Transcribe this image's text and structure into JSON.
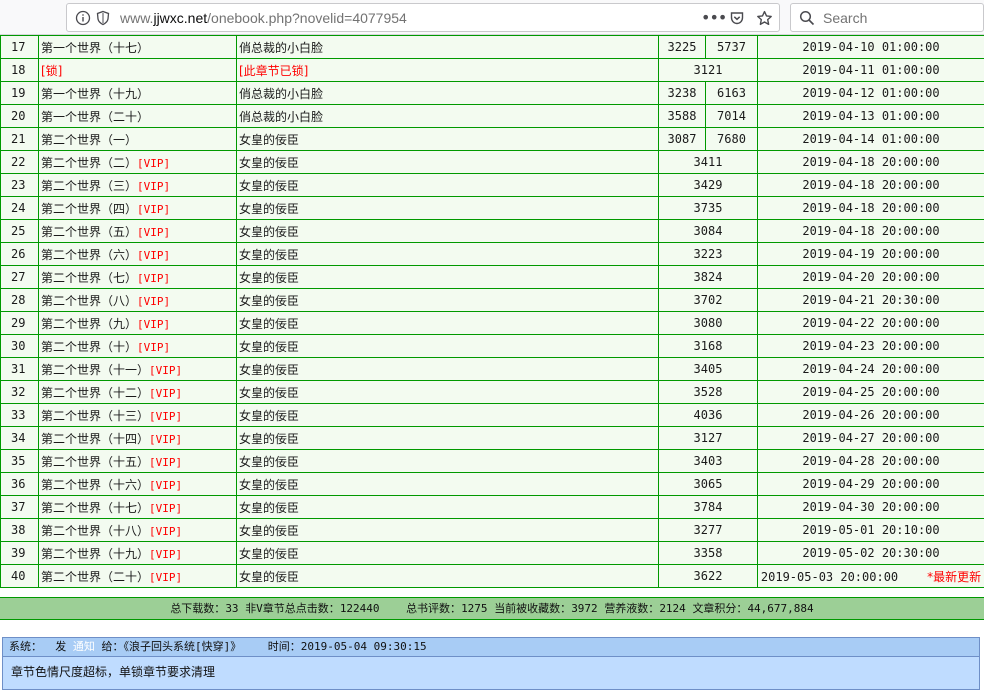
{
  "browser": {
    "url_prefix": "www.",
    "url_domain": "jjwxc.net",
    "url_path": "/onebook.php?novelid=4077954",
    "search_placeholder": "Search"
  },
  "chapters": [
    {
      "no": "17",
      "title": "第一个世界（十七）",
      "vip": "",
      "summary": "俏总裁的小白脸",
      "count": "3225",
      "extra": "5737",
      "date": "2019-04-10 01:00:00",
      "latest": ""
    },
    {
      "no": "18",
      "title": "[锁]",
      "vip": "",
      "summary": "[此章节已锁]",
      "count": "3121",
      "extra": "",
      "date": "2019-04-11 01:00:00",
      "latest": "",
      "locked": true
    },
    {
      "no": "19",
      "title": "第一个世界（十九）",
      "vip": "",
      "summary": "俏总裁的小白脸",
      "count": "3238",
      "extra": "6163",
      "date": "2019-04-12 01:00:00",
      "latest": ""
    },
    {
      "no": "20",
      "title": "第一个世界（二十）",
      "vip": "",
      "summary": "俏总裁的小白脸",
      "count": "3588",
      "extra": "7014",
      "date": "2019-04-13 01:00:00",
      "latest": ""
    },
    {
      "no": "21",
      "title": "第二个世界（一）",
      "vip": "",
      "summary": "女皇的佞臣",
      "count": "3087",
      "extra": "7680",
      "date": "2019-04-14 01:00:00",
      "latest": ""
    },
    {
      "no": "22",
      "title": "第二个世界（二）",
      "vip": "[VIP]",
      "summary": "女皇的佞臣",
      "count": "3411",
      "extra": "",
      "date": "2019-04-18 20:00:00",
      "latest": ""
    },
    {
      "no": "23",
      "title": "第二个世界（三）",
      "vip": "[VIP]",
      "summary": "女皇的佞臣",
      "count": "3429",
      "extra": "",
      "date": "2019-04-18 20:00:00",
      "latest": ""
    },
    {
      "no": "24",
      "title": "第二个世界（四）",
      "vip": "[VIP]",
      "summary": "女皇的佞臣",
      "count": "3735",
      "extra": "",
      "date": "2019-04-18 20:00:00",
      "latest": ""
    },
    {
      "no": "25",
      "title": "第二个世界（五）",
      "vip": "[VIP]",
      "summary": "女皇的佞臣",
      "count": "3084",
      "extra": "",
      "date": "2019-04-18 20:00:00",
      "latest": ""
    },
    {
      "no": "26",
      "title": "第二个世界（六）",
      "vip": "[VIP]",
      "summary": "女皇的佞臣",
      "count": "3223",
      "extra": "",
      "date": "2019-04-19 20:00:00",
      "latest": ""
    },
    {
      "no": "27",
      "title": "第二个世界（七）",
      "vip": "[VIP]",
      "summary": "女皇的佞臣",
      "count": "3824",
      "extra": "",
      "date": "2019-04-20 20:00:00",
      "latest": ""
    },
    {
      "no": "28",
      "title": "第二个世界（八）",
      "vip": "[VIP]",
      "summary": "女皇的佞臣",
      "count": "3702",
      "extra": "",
      "date": "2019-04-21 20:30:00",
      "latest": ""
    },
    {
      "no": "29",
      "title": "第二个世界（九）",
      "vip": "[VIP]",
      "summary": "女皇的佞臣",
      "count": "3080",
      "extra": "",
      "date": "2019-04-22 20:00:00",
      "latest": ""
    },
    {
      "no": "30",
      "title": "第二个世界（十）",
      "vip": "[VIP]",
      "summary": "女皇的佞臣",
      "count": "3168",
      "extra": "",
      "date": "2019-04-23 20:00:00",
      "latest": ""
    },
    {
      "no": "31",
      "title": "第二个世界（十一）",
      "vip": "[VIP]",
      "summary": "女皇的佞臣",
      "count": "3405",
      "extra": "",
      "date": "2019-04-24 20:00:00",
      "latest": ""
    },
    {
      "no": "32",
      "title": "第二个世界（十二）",
      "vip": "[VIP]",
      "summary": "女皇的佞臣",
      "count": "3528",
      "extra": "",
      "date": "2019-04-25 20:00:00",
      "latest": ""
    },
    {
      "no": "33",
      "title": "第二个世界（十三）",
      "vip": "[VIP]",
      "summary": "女皇的佞臣",
      "count": "4036",
      "extra": "",
      "date": "2019-04-26 20:00:00",
      "latest": ""
    },
    {
      "no": "34",
      "title": "第二个世界（十四）",
      "vip": "[VIP]",
      "summary": "女皇的佞臣",
      "count": "3127",
      "extra": "",
      "date": "2019-04-27 20:00:00",
      "latest": ""
    },
    {
      "no": "35",
      "title": "第二个世界（十五）",
      "vip": "[VIP]",
      "summary": "女皇的佞臣",
      "count": "3403",
      "extra": "",
      "date": "2019-04-28 20:00:00",
      "latest": ""
    },
    {
      "no": "36",
      "title": "第二个世界（十六）",
      "vip": "[VIP]",
      "summary": "女皇的佞臣",
      "count": "3065",
      "extra": "",
      "date": "2019-04-29 20:00:00",
      "latest": ""
    },
    {
      "no": "37",
      "title": "第二个世界（十七）",
      "vip": "[VIP]",
      "summary": "女皇的佞臣",
      "count": "3784",
      "extra": "",
      "date": "2019-04-30 20:00:00",
      "latest": ""
    },
    {
      "no": "38",
      "title": "第二个世界（十八）",
      "vip": "[VIP]",
      "summary": "女皇的佞臣",
      "count": "3277",
      "extra": "",
      "date": "2019-05-01 20:10:00",
      "latest": ""
    },
    {
      "no": "39",
      "title": "第二个世界（十九）",
      "vip": "[VIP]",
      "summary": "女皇的佞臣",
      "count": "3358",
      "extra": "",
      "date": "2019-05-02 20:30:00",
      "latest": ""
    },
    {
      "no": "40",
      "title": "第二个世界（二十）",
      "vip": "[VIP]",
      "summary": "女皇的佞臣",
      "count": "3622",
      "extra": "",
      "date": "2019-05-03 20:00:00",
      "latest": "*最新更新"
    }
  ],
  "stats": {
    "downloads_label": "总下载数：",
    "downloads": "33",
    "clicks_label": "非V章节总点击数：",
    "clicks": "122440",
    "reviews_label": "总书评数：",
    "reviews": "1275",
    "favorites_label": "当前被收藏数：",
    "favorites": "3972",
    "nutrition_label": "营养液数：",
    "nutrition": "2124",
    "score_label": "文章积分：",
    "score": "44,677,884"
  },
  "system_notice": {
    "sys_label": "系统：",
    "send_label": "发",
    "notice_label": "通知",
    "to_label": "给：",
    "book_title": "《浪子回头系统[快穿]》",
    "time_label": "时间：",
    "time": "2019-05-04 09:30:15",
    "message": "章节色情尺度超标，单锁章节要求清理"
  },
  "colors": {
    "border": "#009900",
    "row_bg": "#f3fbf0",
    "stats_bg": "#9ccf96",
    "vip": "#ff0000",
    "notice_bg": "#bfdcff"
  }
}
